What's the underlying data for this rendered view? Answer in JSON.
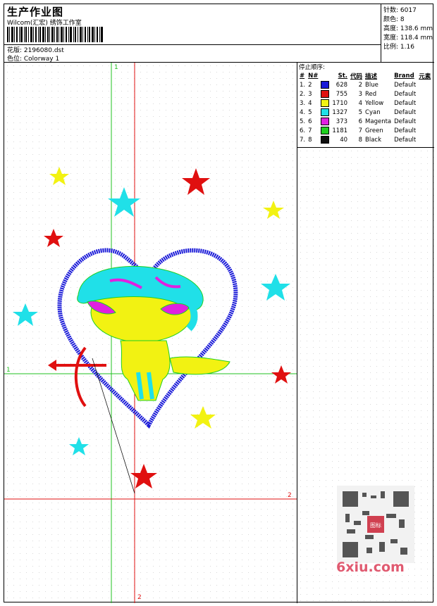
{
  "header": {
    "title": "生产作业图",
    "company": "Wilcom(汇宏) 绣饰工作室",
    "design_label": "花版: 2196080.dst",
    "colorway_label": "色位:  Colorway 1"
  },
  "specs": {
    "stitches": "针数: 6017",
    "colors": "颜色: 8",
    "height": "高度: 138.6 mm",
    "width": "宽度: 118.4 mm",
    "ratio": "比例: 1.16"
  },
  "legend": {
    "title": "停止顺序:",
    "columns": [
      "#",
      "N#",
      "St.",
      "代码",
      "描述",
      "Brand",
      "元素"
    ],
    "rows": [
      {
        "idx": "1.",
        "n": "2",
        "st": "628",
        "code": "2",
        "desc": "Blue",
        "brand": "Default",
        "color": "#1a1ad8"
      },
      {
        "idx": "2.",
        "n": "3",
        "st": "755",
        "code": "3",
        "desc": "Red",
        "brand": "Default",
        "color": "#e01010"
      },
      {
        "idx": "3.",
        "n": "4",
        "st": "1710",
        "code": "4",
        "desc": "Yellow",
        "brand": "Default",
        "color": "#f2f212"
      },
      {
        "idx": "4.",
        "n": "5",
        "st": "1327",
        "code": "5",
        "desc": "Cyan",
        "brand": "Default",
        "color": "#20e0e8"
      },
      {
        "idx": "5.",
        "n": "6",
        "st": "373",
        "code": "6",
        "desc": "Magenta",
        "brand": "Default",
        "color": "#e020e0"
      },
      {
        "idx": "6.",
        "n": "7",
        "st": "1181",
        "code": "7",
        "desc": "Green",
        "brand": "Default",
        "color": "#20d020"
      },
      {
        "idx": "7.",
        "n": "8",
        "st": "40",
        "code": "8",
        "desc": "Black",
        "brand": "Default",
        "color": "#101010"
      }
    ]
  },
  "guides": {
    "green_v": "1",
    "green_h": "1",
    "red_h": "2",
    "red_v": "2"
  },
  "watermark": {
    "site": "6xiu.com",
    "qr_badge": "图标"
  }
}
